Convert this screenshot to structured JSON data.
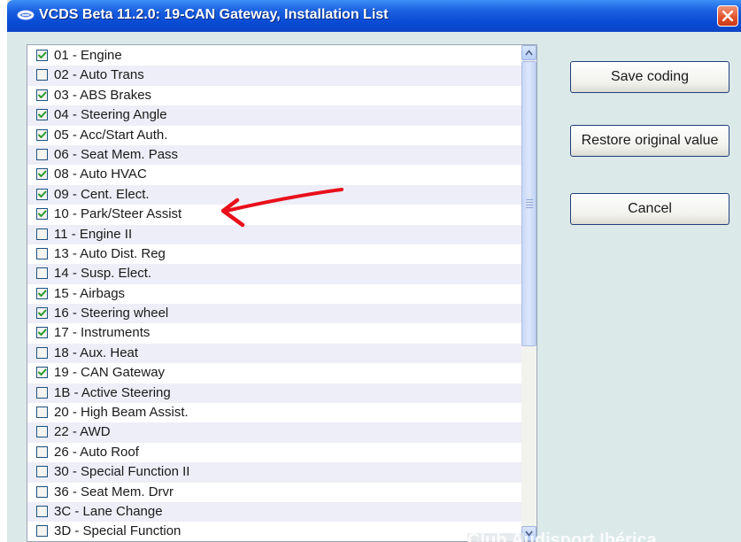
{
  "window": {
    "title": "VCDS Beta 11.2.0: 19-CAN Gateway,  Installation List"
  },
  "list": {
    "items": [
      {
        "label": "01 - Engine",
        "checked": true
      },
      {
        "label": "02 - Auto Trans",
        "checked": false
      },
      {
        "label": "03 - ABS Brakes",
        "checked": true
      },
      {
        "label": "04 - Steering Angle",
        "checked": true
      },
      {
        "label": "05 - Acc/Start Auth.",
        "checked": true
      },
      {
        "label": "06 - Seat Mem. Pass",
        "checked": false
      },
      {
        "label": "08 - Auto HVAC",
        "checked": true
      },
      {
        "label": "09 - Cent. Elect.",
        "checked": true
      },
      {
        "label": "10 - Park/Steer Assist",
        "checked": true
      },
      {
        "label": "11 - Engine II",
        "checked": false
      },
      {
        "label": "13 - Auto Dist. Reg",
        "checked": false
      },
      {
        "label": "14 - Susp. Elect.",
        "checked": false
      },
      {
        "label": "15 - Airbags",
        "checked": true
      },
      {
        "label": "16 - Steering wheel",
        "checked": true
      },
      {
        "label": "17 - Instruments",
        "checked": true
      },
      {
        "label": "18 - Aux. Heat",
        "checked": false
      },
      {
        "label": "19 - CAN Gateway",
        "checked": true
      },
      {
        "label": "1B - Active Steering",
        "checked": false
      },
      {
        "label": "20 - High Beam Assist.",
        "checked": false
      },
      {
        "label": "22 - AWD",
        "checked": false
      },
      {
        "label": "26 - Auto Roof",
        "checked": false
      },
      {
        "label": "30 - Special Function II",
        "checked": false
      },
      {
        "label": "36 - Seat Mem. Drvr",
        "checked": false
      },
      {
        "label": "3C - Lane Change",
        "checked": false
      },
      {
        "label": "3D - Special Function",
        "checked": false
      }
    ]
  },
  "buttons": {
    "save": "Save coding",
    "restore": "Restore original value",
    "cancel": "Cancel"
  },
  "watermark": "Club Audisport Ibérica",
  "colors": {
    "titlebar": "#0a4bd4",
    "client_bg": "#dce9e9",
    "arrow": "#e8101a",
    "check": "#2a9a2a"
  },
  "icons": {
    "app": "vcds-logo-icon",
    "close": "close-icon",
    "checkbox": "checkbox-icon",
    "scroll_up": "scroll-up-icon",
    "scroll_down": "scroll-down-icon",
    "annotation": "red-arrow-annotation"
  }
}
